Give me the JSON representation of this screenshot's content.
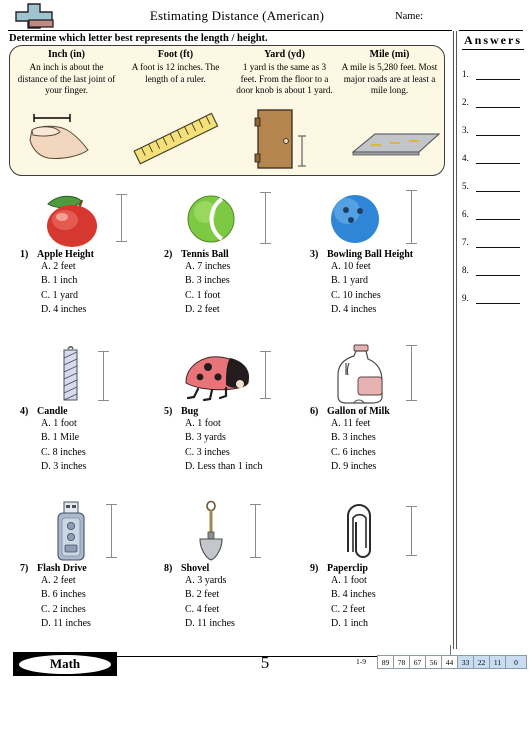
{
  "header": {
    "title": "Estimating Distance (American)",
    "name_label": "Name:",
    "logo_icon": "plus-block-logo"
  },
  "instruction": "Determine which letter best represents the length / height.",
  "reference": {
    "columns": [
      {
        "head": "Inch (in)",
        "body": "An inch is about the distance of the last joint of your finger.",
        "art": "finger-measure-illustration"
      },
      {
        "head": "Foot (ft)",
        "body": "A foot is 12 inches. The length of a ruler.",
        "art": "ruler-illustration"
      },
      {
        "head": "Yard (yd)",
        "body": "1 yard is the same as 3 feet. From the floor to a door knob is about 1 yard.",
        "art": "door-illustration"
      },
      {
        "head": "Mile (mi)",
        "body": "A mile is 5,280 feet. Most major roads are at least a mile long.",
        "art": "road-illustration"
      }
    ]
  },
  "questions": [
    {
      "num": "1)",
      "label": "Apple Height",
      "art": "apple-illustration",
      "options": [
        "A. 2 feet",
        "B. 1 inch",
        "C. 1 yard",
        "D. 4 inches"
      ]
    },
    {
      "num": "2)",
      "label": "Tennis Ball",
      "art": "tennis-ball-illustration",
      "options": [
        "A. 7 inches",
        "B. 3 inches",
        "C. 1 foot",
        "D. 2 feet"
      ]
    },
    {
      "num": "3)",
      "label": "Bowling Ball Height",
      "art": "bowling-ball-illustration",
      "options": [
        "A. 10 feet",
        "B. 1 yard",
        "C. 10 inches",
        "D. 4 inches"
      ]
    },
    {
      "num": "4)",
      "label": "Candle",
      "art": "candle-illustration",
      "options": [
        "A. 1 foot",
        "B. 1 Mile",
        "C. 8 inches",
        "D. 3 inches"
      ]
    },
    {
      "num": "5)",
      "label": "Bug",
      "art": "ladybug-illustration",
      "options": [
        "A. 1 foot",
        "B. 3 yards",
        "C. 3 inches",
        "D. Less than 1 inch"
      ]
    },
    {
      "num": "6)",
      "label": "Gallon of Milk",
      "art": "milk-jug-illustration",
      "options": [
        "A. 11 feet",
        "B. 3 inches",
        "C. 6 inches",
        "D. 9 inches"
      ]
    },
    {
      "num": "7)",
      "label": "Flash Drive",
      "art": "flash-drive-illustration",
      "options": [
        "A. 2 feet",
        "B. 6 inches",
        "C. 2 inches",
        "D. 11 inches"
      ]
    },
    {
      "num": "8)",
      "label": "Shovel",
      "art": "shovel-illustration",
      "options": [
        "A. 3 yards",
        "B. 2 feet",
        "C. 4 feet",
        "D. 11 inches"
      ]
    },
    {
      "num": "9)",
      "label": "Paperclip",
      "art": "paperclip-illustration",
      "options": [
        "A. 1 foot",
        "B. 4 inches",
        "C. 2 feet",
        "D. 1 inch"
      ]
    }
  ],
  "answers": {
    "title": "Answers",
    "rows": [
      "1.",
      "2.",
      "3.",
      "4.",
      "5.",
      "6.",
      "7.",
      "8.",
      "9."
    ]
  },
  "footer": {
    "brand": "Math",
    "page_number": "5",
    "scale_label": "1-9",
    "scale_values": [
      "89",
      "78",
      "67",
      "56",
      "44",
      "33",
      "22",
      "11",
      "0"
    ],
    "scale_highlight_from": 5
  },
  "colors": {
    "refbox_fill": "#fdf8e3",
    "apple_red": "#d6372f",
    "leaf_green": "#3f8a34",
    "tennis_green": "#7dc943",
    "bowling_blue": "#2f86d6",
    "door_brown": "#b08149",
    "ruler_yellow": "#f5e07a",
    "road_gray": "#b9bcc0",
    "milk_pink": "#e7b2b2",
    "bug_red": "#e8747a",
    "drive_blue": "#aab9cc",
    "highlight_blue": "#c9ddf2"
  }
}
